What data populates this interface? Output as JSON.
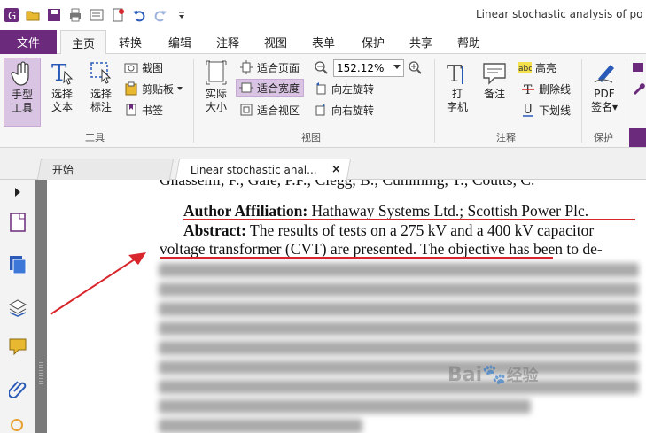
{
  "window": {
    "title": "Linear stochastic analysis of po"
  },
  "ribbon_tabs": [
    {
      "label": "文件"
    },
    {
      "label": "主页"
    },
    {
      "label": "转换"
    },
    {
      "label": "编辑"
    },
    {
      "label": "注释"
    },
    {
      "label": "视图"
    },
    {
      "label": "表单"
    },
    {
      "label": "保护"
    },
    {
      "label": "共享"
    },
    {
      "label": "帮助"
    }
  ],
  "tools": {
    "hand": "手型\n工具",
    "hand_l1": "手型",
    "hand_l2": "工具",
    "select_text_l1": "选择",
    "select_text_l2": "文本",
    "select_annot_l1": "选择",
    "select_annot_l2": "标注",
    "snapshot": "截图",
    "clipboard": "剪贴板",
    "bookmark": "书签",
    "group": "工具"
  },
  "view": {
    "actual_l1": "实际",
    "actual_l2": "大小",
    "fit_page": "适合页面",
    "fit_width": "适合宽度",
    "fit_visible": "适合视区",
    "zoom": "152.12%",
    "rotate_left": "向左旋转",
    "rotate_right": "向右旋转",
    "group": "视图"
  },
  "comment": {
    "type_l1": "打",
    "type_l2": "字机",
    "note": "备注",
    "highlight": "高亮",
    "strikeout": "删除线",
    "underline": "下划线",
    "group": "注释"
  },
  "protect": {
    "sign_l1": "PDF",
    "sign_l2": "签名",
    "group": "保护"
  },
  "doc_tabs": {
    "start": "开始",
    "current": "Linear stochastic anal..."
  },
  "document": {
    "line0": "Ghassemi, F.; Gale, P.F.; Clegg, B.; Cumming, T.; Coutts, C.",
    "affil_label": "Author Affiliation:",
    "affil_value": " Hathaway Systems Ltd.; Scottish Power Plc.",
    "abstract_label": "Abstract:",
    "abstract_l1": " The results of tests on a 275 kV and a 400 kV capacitor",
    "abstract_l2": "voltage transformer (CVT) are presented. The objective has been to de-",
    "last_line": "CVT frequency characteristic."
  },
  "watermark": {
    "brand": "Bai",
    "suffix": "经验"
  },
  "colors": {
    "accent": "#6b2a7b",
    "annotation_red": "#d8262c"
  }
}
